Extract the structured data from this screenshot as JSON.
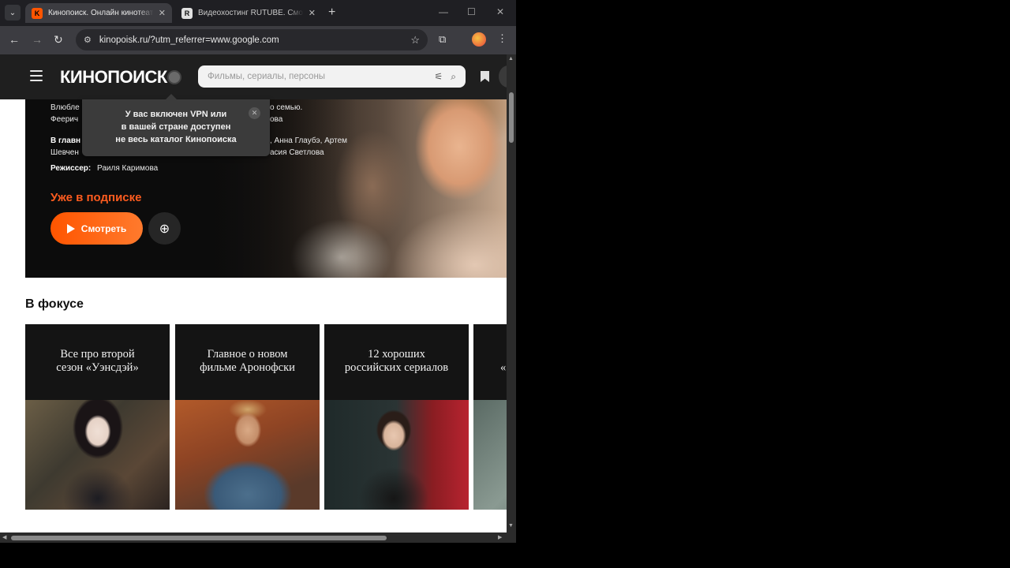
{
  "browser": {
    "tabs": [
      {
        "title": "Кинопоиск. Онлайн кинотеатр",
        "favicon": "kinopoisk-favicon",
        "active": true
      },
      {
        "title": "Видеохостинг RUTUBE. Смотрите",
        "favicon": "rutube-favicon",
        "active": false
      }
    ],
    "url": "kinopoisk.ru/?utm_referrer=www.google.com",
    "icons": {
      "back": "←",
      "forward": "→",
      "reload": "↻",
      "site_info": "⚙",
      "bookmark_star": "☆",
      "extensions": "⧉",
      "menu": "⋮",
      "new_tab": "+",
      "close_tab": "✕",
      "minimize": "—",
      "maximize": "☐",
      "close_window": "✕",
      "tab_search": "⌄"
    }
  },
  "site": {
    "logo": "КИНОПОИСК",
    "search_placeholder": "Фильмы, сериалы, персоны",
    "icons": {
      "filter": "⚟",
      "search": "⌕"
    }
  },
  "hero": {
    "description_line1": "Влюбле",
    "description_line1_end": "о семью.",
    "description_line2": "Феерич",
    "description_line2_end": "ова",
    "cast_label": "В главн",
    "cast_line1_end": ", Анна Глаубэ, Артем",
    "cast_line2_start": "Шевчен",
    "cast_line2_end": "асия Светлова",
    "director_label": "Режиссер:",
    "director_name": "Раиля Каримова",
    "subscription_text": "Уже в подписке",
    "watch_label": "Смотреть",
    "favorite_icon": "⊕"
  },
  "vpn_tooltip": {
    "line1": "У вас включен VPN или",
    "line2": "в вашей стране доступен",
    "line3": "не весь каталог Кинопоиска",
    "close": "✕"
  },
  "focus": {
    "title": "В фокусе",
    "cards": [
      {
        "line1": "Все про второй",
        "line2": "сезон «Уэнсдэй»"
      },
      {
        "line1": "Главное о новом",
        "line2": "фильме Аронофски"
      },
      {
        "line1": "12 хороших",
        "line2": "российских сериалов"
      },
      {
        "line1": "«",
        "line2": ""
      }
    ]
  },
  "colors": {
    "accent": "#ff5500",
    "subscription": "#ff5c1f",
    "header_bg": "#1f1f1f",
    "browser_chrome": "#3c3c41"
  }
}
